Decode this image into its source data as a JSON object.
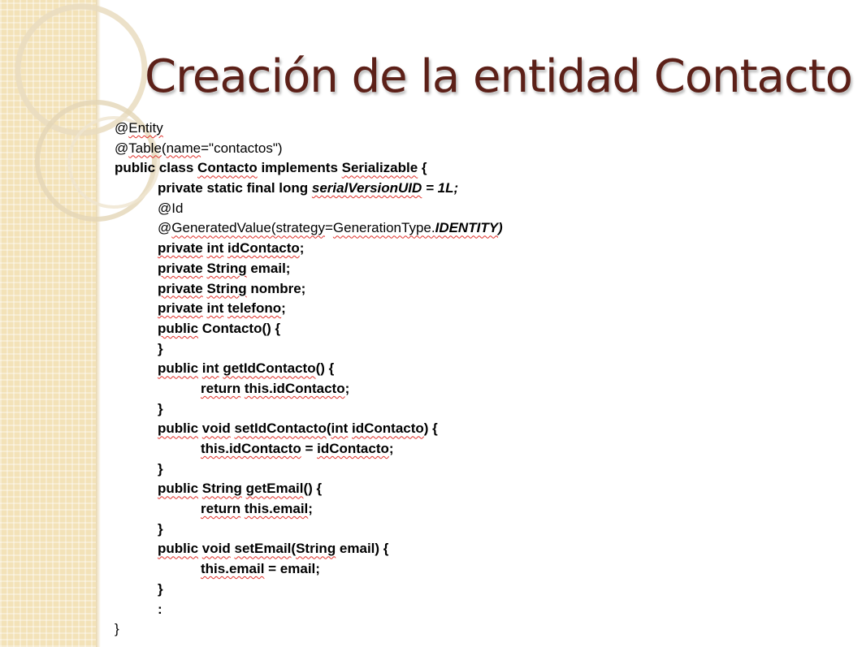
{
  "slide": {
    "title": "Creación de la entidad Contacto",
    "colors": {
      "title": "#5c2018",
      "band": "#f3e2b8",
      "spellcheck": "#e0302a"
    }
  },
  "code": {
    "l1": {
      "a": "@",
      "b": "Entity"
    },
    "l2": {
      "a": "@",
      "b": "Table",
      "c": "(",
      "d": "name",
      "e": "=\"contactos\")"
    },
    "l3": {
      "a": "public class ",
      "b": "Contacto",
      "c": " implements ",
      "d": "Serializable",
      "e": " {"
    },
    "l4": {
      "a": "private static final long ",
      "b": "serialVersionUID",
      "c": " = 1L;"
    },
    "l5": {
      "a": "@Id"
    },
    "l6": {
      "a": "@",
      "b": "GeneratedValue(strategy",
      "c": "=",
      "d": "GenerationType.",
      "e": "IDENTITY",
      "f": ")"
    },
    "l7": {
      "a": "private",
      "b": " ",
      "c": "int",
      "d": " ",
      "e": "idContacto",
      "f": ";"
    },
    "l8": {
      "a": "private",
      "b": " ",
      "c": "String",
      "d": " email;"
    },
    "l9": {
      "a": "private",
      "b": " ",
      "c": "String",
      "d": " nombre;"
    },
    "l10": {
      "a": "private",
      "b": " ",
      "c": "int",
      "d": " ",
      "e": "telefono",
      "f": ";"
    },
    "l11": {
      "a": "public",
      "b": " Contacto() {"
    },
    "l12": {
      "a": "}"
    },
    "l13": {
      "a": "public",
      "b": " ",
      "c": "int",
      "d": " ",
      "e": "getIdContacto",
      "f": "() {"
    },
    "l14": {
      "a": "return",
      "b": " ",
      "c": "this.idContacto",
      "d": ";"
    },
    "l15": {
      "a": "}"
    },
    "l16": {
      "a": "public",
      "b": " ",
      "c": "void",
      "d": " ",
      "e": "setIdContacto",
      "f": "(",
      "g": "int",
      "h": " ",
      "i": "idContacto",
      "j": ") {"
    },
    "l17": {
      "a": "this.idContacto",
      "b": " = ",
      "c": "idContacto",
      "d": ";"
    },
    "l18": {
      "a": "}"
    },
    "l19": {
      "a": "public",
      "b": " ",
      "c": "String",
      "d": " ",
      "e": "getEmail",
      "f": "() {"
    },
    "l20": {
      "a": "return",
      "b": " ",
      "c": "this.email",
      "d": ";"
    },
    "l21": {
      "a": "}"
    },
    "l22": {
      "a": "public",
      "b": " ",
      "c": "void",
      "d": " ",
      "e": "setEmail",
      "f": "(",
      "g": "String",
      "h": " email) {"
    },
    "l23": {
      "a": "this.email",
      "b": " = email;"
    },
    "l24": {
      "a": "}"
    },
    "l25": {
      "a": ":"
    },
    "l26": {
      "a": "}"
    }
  }
}
